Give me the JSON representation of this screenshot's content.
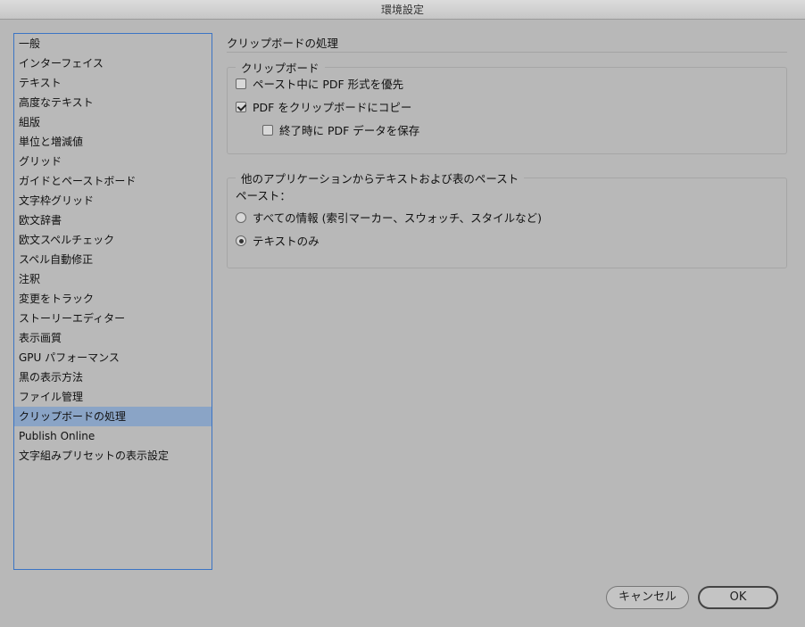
{
  "window": {
    "title": "環境設定"
  },
  "sidebar": {
    "selected_index": 19,
    "items": [
      "一般",
      "インターフェイス",
      "テキスト",
      "高度なテキスト",
      "組版",
      "単位と増減値",
      "グリッド",
      "ガイドとペーストボード",
      "文字枠グリッド",
      "欧文辞書",
      "欧文スペルチェック",
      "スペル自動修正",
      "注釈",
      "変更をトラック",
      "ストーリーエディター",
      "表示画質",
      "GPU パフォーマンス",
      "黒の表示方法",
      "ファイル管理",
      "クリップボードの処理",
      "Publish Online",
      "文字組みプリセットの表示設定"
    ]
  },
  "panel": {
    "title": "クリップボードの処理",
    "clipboard_group": {
      "legend": "クリップボード",
      "prefer_pdf_label": "ペースト中に PDF 形式を優先",
      "prefer_pdf_checked": false,
      "copy_pdf_label": "PDF をクリップボードにコピー",
      "copy_pdf_checked": true,
      "save_pdf_on_quit_label": "終了時に PDF データを保存",
      "save_pdf_on_quit_checked": false
    },
    "paste_group": {
      "legend": "他のアプリケーションからテキストおよび表のペースト",
      "paste_label": "ペースト：",
      "all_info_label": "すべての情報 (索引マーカー、スウォッチ、スタイルなど)",
      "all_info_selected": false,
      "text_only_label": "テキストのみ",
      "text_only_selected": true
    }
  },
  "buttons": {
    "cancel": "キャンセル",
    "ok": "OK"
  },
  "colors": {
    "selection": "#8aa4c6",
    "focus_border": "#3b74c4",
    "background": "#b8b8b8"
  }
}
